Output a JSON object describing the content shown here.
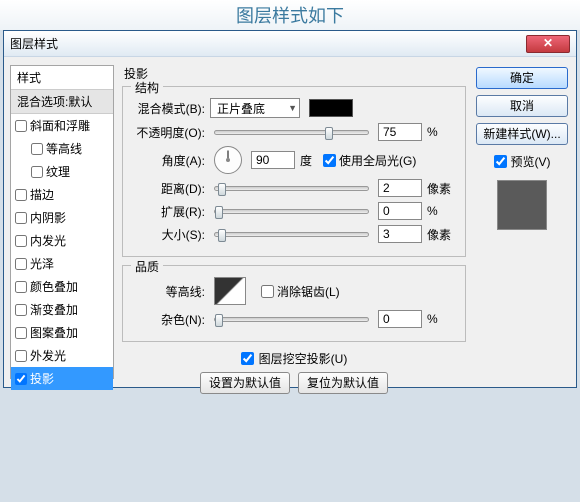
{
  "caption": "图层样式如下",
  "window": {
    "title": "图层样式",
    "close": "✕"
  },
  "left": {
    "header": "样式",
    "blendDefault": "混合选项:默认",
    "items": [
      {
        "label": "斜面和浮雕",
        "indent": false,
        "checked": false
      },
      {
        "label": "等高线",
        "indent": true,
        "checked": false
      },
      {
        "label": "纹理",
        "indent": true,
        "checked": false
      },
      {
        "label": "描边",
        "indent": false,
        "checked": false
      },
      {
        "label": "内阴影",
        "indent": false,
        "checked": false
      },
      {
        "label": "内发光",
        "indent": false,
        "checked": false
      },
      {
        "label": "光泽",
        "indent": false,
        "checked": false
      },
      {
        "label": "颜色叠加",
        "indent": false,
        "checked": false
      },
      {
        "label": "渐变叠加",
        "indent": false,
        "checked": false
      },
      {
        "label": "图案叠加",
        "indent": false,
        "checked": false
      },
      {
        "label": "外发光",
        "indent": false,
        "checked": false
      },
      {
        "label": "投影",
        "indent": false,
        "checked": true,
        "active": true
      }
    ]
  },
  "mid": {
    "title": "投影",
    "structure": {
      "legend": "结构",
      "blendMode": {
        "label": "混合模式(B):",
        "value": "正片叠底"
      },
      "opacity": {
        "label": "不透明度(O):",
        "value": "75",
        "unit": "%",
        "pos": 72
      },
      "angle": {
        "label": "角度(A):",
        "value": "90",
        "unit": "度"
      },
      "global": {
        "label": "使用全局光(G)",
        "checked": true
      },
      "distance": {
        "label": "距离(D):",
        "value": "2",
        "unit": "像素",
        "pos": 2
      },
      "spread": {
        "label": "扩展(R):",
        "value": "0",
        "unit": "%",
        "pos": 0
      },
      "size": {
        "label": "大小(S):",
        "value": "3",
        "unit": "像素",
        "pos": 2
      }
    },
    "quality": {
      "legend": "品质",
      "contour": {
        "label": "等高线:"
      },
      "antialias": {
        "label": "消除锯齿(L)",
        "checked": false
      },
      "noise": {
        "label": "杂色(N):",
        "value": "0",
        "unit": "%",
        "pos": 0
      }
    },
    "knockout": {
      "label": "图层挖空投影(U)",
      "checked": true
    },
    "setDefault": "设置为默认值",
    "resetDefault": "复位为默认值"
  },
  "right": {
    "ok": "确定",
    "cancel": "取消",
    "newStyle": "新建样式(W)...",
    "preview": {
      "label": "预览(V)",
      "checked": true
    }
  }
}
